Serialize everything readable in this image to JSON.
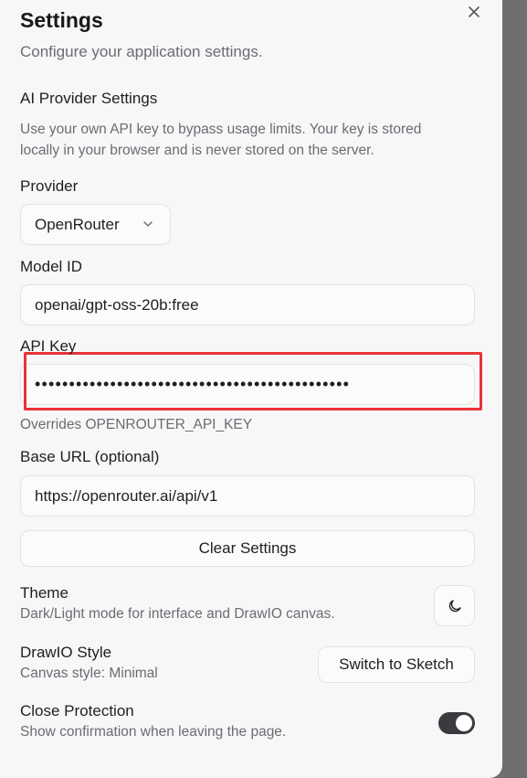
{
  "dialog": {
    "title": "Settings",
    "subtitle": "Configure your application settings."
  },
  "ai_provider": {
    "section_title": "AI Provider Settings",
    "description": "Use your own API key to bypass usage limits. Your key is stored locally in your browser and is never stored on the server.",
    "provider_label": "Provider",
    "provider_value": "OpenRouter",
    "model_label": "Model ID",
    "model_value": "openai/gpt-oss-20b:free",
    "api_key_label": "API Key",
    "api_key_masked": "••••••••••••••••••••••••••••••••••••••••••••••",
    "api_key_hint": "Overrides OPENROUTER_API_KEY",
    "base_url_label": "Base URL (optional)",
    "base_url_value": "https://openrouter.ai/api/v1",
    "clear_button": "Clear Settings"
  },
  "theme": {
    "title": "Theme",
    "description": "Dark/Light mode for interface and DrawIO canvas.",
    "icon": "moon-icon"
  },
  "drawio_style": {
    "title": "DrawIO Style",
    "description": "Canvas style: Minimal",
    "button": "Switch to Sketch"
  },
  "close_protection": {
    "title": "Close Protection",
    "description": "Show confirmation when leaving the page.",
    "enabled": true
  },
  "colors": {
    "highlight": "#e8323a",
    "toggle_on": "#3a3a3f",
    "panel": "#f7f7f8"
  }
}
